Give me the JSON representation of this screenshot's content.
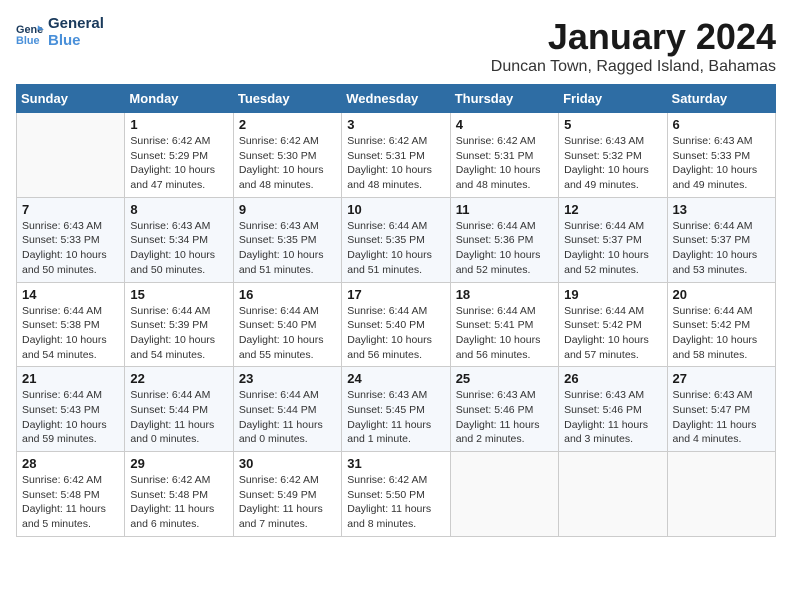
{
  "logo": {
    "line1": "General",
    "line2": "Blue"
  },
  "title": "January 2024",
  "location": "Duncan Town, Ragged Island, Bahamas",
  "header_color": "#2e6da4",
  "days_of_week": [
    "Sunday",
    "Monday",
    "Tuesday",
    "Wednesday",
    "Thursday",
    "Friday",
    "Saturday"
  ],
  "weeks": [
    [
      {
        "day": "",
        "info": ""
      },
      {
        "day": "1",
        "info": "Sunrise: 6:42 AM\nSunset: 5:29 PM\nDaylight: 10 hours\nand 47 minutes."
      },
      {
        "day": "2",
        "info": "Sunrise: 6:42 AM\nSunset: 5:30 PM\nDaylight: 10 hours\nand 48 minutes."
      },
      {
        "day": "3",
        "info": "Sunrise: 6:42 AM\nSunset: 5:31 PM\nDaylight: 10 hours\nand 48 minutes."
      },
      {
        "day": "4",
        "info": "Sunrise: 6:42 AM\nSunset: 5:31 PM\nDaylight: 10 hours\nand 48 minutes."
      },
      {
        "day": "5",
        "info": "Sunrise: 6:43 AM\nSunset: 5:32 PM\nDaylight: 10 hours\nand 49 minutes."
      },
      {
        "day": "6",
        "info": "Sunrise: 6:43 AM\nSunset: 5:33 PM\nDaylight: 10 hours\nand 49 minutes."
      }
    ],
    [
      {
        "day": "7",
        "info": "Sunrise: 6:43 AM\nSunset: 5:33 PM\nDaylight: 10 hours\nand 50 minutes."
      },
      {
        "day": "8",
        "info": "Sunrise: 6:43 AM\nSunset: 5:34 PM\nDaylight: 10 hours\nand 50 minutes."
      },
      {
        "day": "9",
        "info": "Sunrise: 6:43 AM\nSunset: 5:35 PM\nDaylight: 10 hours\nand 51 minutes."
      },
      {
        "day": "10",
        "info": "Sunrise: 6:44 AM\nSunset: 5:35 PM\nDaylight: 10 hours\nand 51 minutes."
      },
      {
        "day": "11",
        "info": "Sunrise: 6:44 AM\nSunset: 5:36 PM\nDaylight: 10 hours\nand 52 minutes."
      },
      {
        "day": "12",
        "info": "Sunrise: 6:44 AM\nSunset: 5:37 PM\nDaylight: 10 hours\nand 52 minutes."
      },
      {
        "day": "13",
        "info": "Sunrise: 6:44 AM\nSunset: 5:37 PM\nDaylight: 10 hours\nand 53 minutes."
      }
    ],
    [
      {
        "day": "14",
        "info": "Sunrise: 6:44 AM\nSunset: 5:38 PM\nDaylight: 10 hours\nand 54 minutes."
      },
      {
        "day": "15",
        "info": "Sunrise: 6:44 AM\nSunset: 5:39 PM\nDaylight: 10 hours\nand 54 minutes."
      },
      {
        "day": "16",
        "info": "Sunrise: 6:44 AM\nSunset: 5:40 PM\nDaylight: 10 hours\nand 55 minutes."
      },
      {
        "day": "17",
        "info": "Sunrise: 6:44 AM\nSunset: 5:40 PM\nDaylight: 10 hours\nand 56 minutes."
      },
      {
        "day": "18",
        "info": "Sunrise: 6:44 AM\nSunset: 5:41 PM\nDaylight: 10 hours\nand 56 minutes."
      },
      {
        "day": "19",
        "info": "Sunrise: 6:44 AM\nSunset: 5:42 PM\nDaylight: 10 hours\nand 57 minutes."
      },
      {
        "day": "20",
        "info": "Sunrise: 6:44 AM\nSunset: 5:42 PM\nDaylight: 10 hours\nand 58 minutes."
      }
    ],
    [
      {
        "day": "21",
        "info": "Sunrise: 6:44 AM\nSunset: 5:43 PM\nDaylight: 10 hours\nand 59 minutes."
      },
      {
        "day": "22",
        "info": "Sunrise: 6:44 AM\nSunset: 5:44 PM\nDaylight: 11 hours\nand 0 minutes."
      },
      {
        "day": "23",
        "info": "Sunrise: 6:44 AM\nSunset: 5:44 PM\nDaylight: 11 hours\nand 0 minutes."
      },
      {
        "day": "24",
        "info": "Sunrise: 6:43 AM\nSunset: 5:45 PM\nDaylight: 11 hours\nand 1 minute."
      },
      {
        "day": "25",
        "info": "Sunrise: 6:43 AM\nSunset: 5:46 PM\nDaylight: 11 hours\nand 2 minutes."
      },
      {
        "day": "26",
        "info": "Sunrise: 6:43 AM\nSunset: 5:46 PM\nDaylight: 11 hours\nand 3 minutes."
      },
      {
        "day": "27",
        "info": "Sunrise: 6:43 AM\nSunset: 5:47 PM\nDaylight: 11 hours\nand 4 minutes."
      }
    ],
    [
      {
        "day": "28",
        "info": "Sunrise: 6:42 AM\nSunset: 5:48 PM\nDaylight: 11 hours\nand 5 minutes."
      },
      {
        "day": "29",
        "info": "Sunrise: 6:42 AM\nSunset: 5:48 PM\nDaylight: 11 hours\nand 6 minutes."
      },
      {
        "day": "30",
        "info": "Sunrise: 6:42 AM\nSunset: 5:49 PM\nDaylight: 11 hours\nand 7 minutes."
      },
      {
        "day": "31",
        "info": "Sunrise: 6:42 AM\nSunset: 5:50 PM\nDaylight: 11 hours\nand 8 minutes."
      },
      {
        "day": "",
        "info": ""
      },
      {
        "day": "",
        "info": ""
      },
      {
        "day": "",
        "info": ""
      }
    ]
  ]
}
